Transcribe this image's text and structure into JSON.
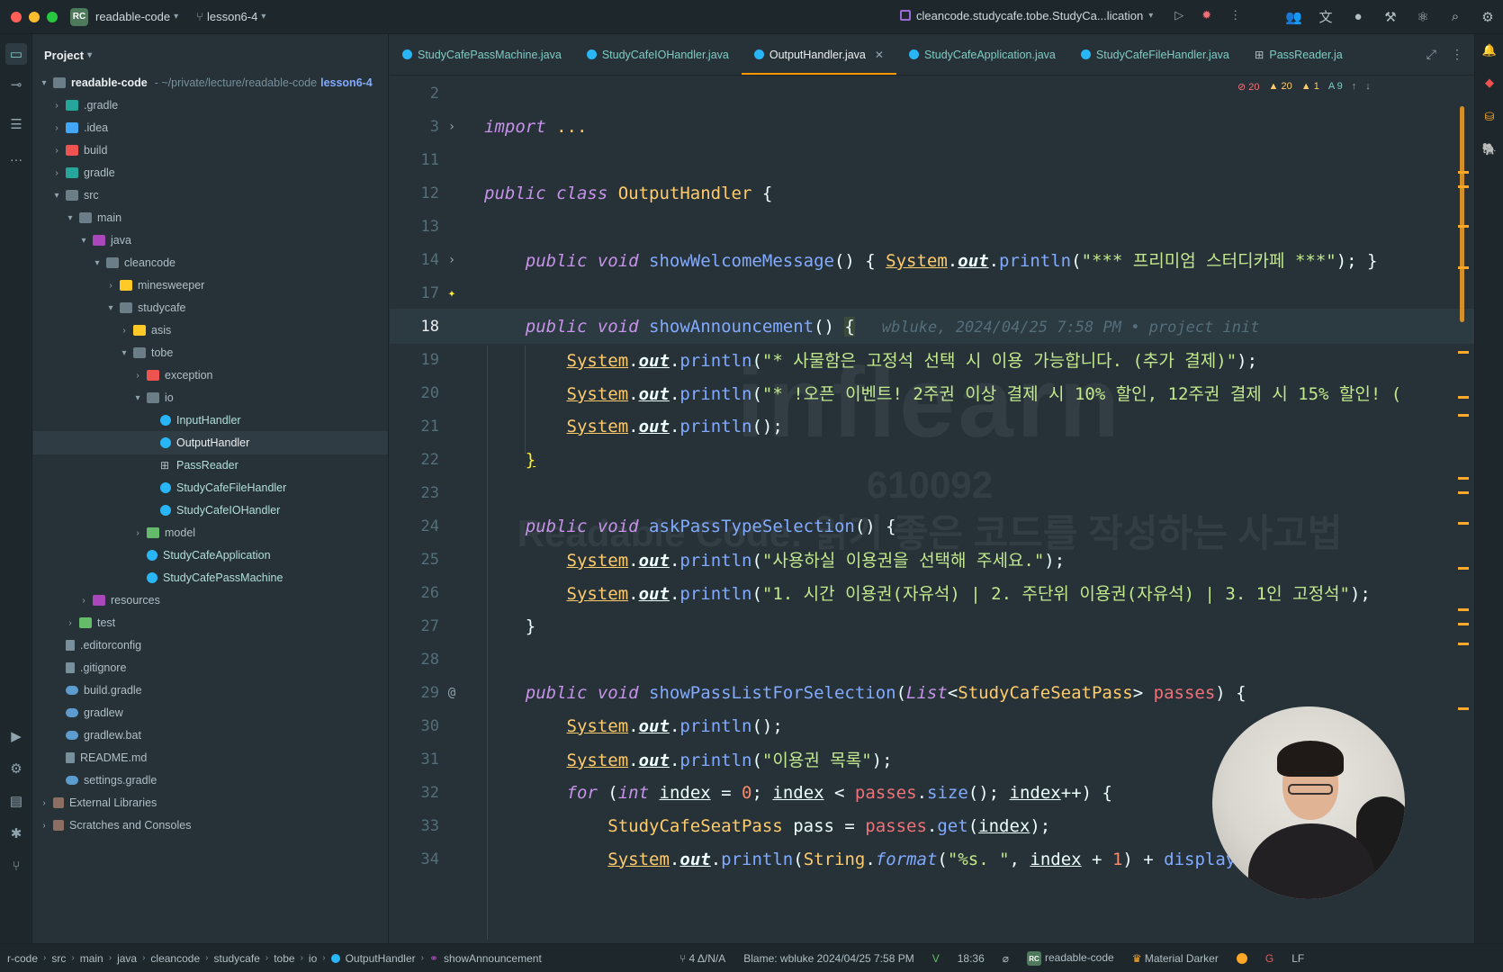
{
  "titlebar": {
    "project_badge": "RC",
    "project_name": "readable-code",
    "branch": "lesson6-4",
    "run_config": "cleancode.studycafe.tobe.StudyCa...lication"
  },
  "project_panel": {
    "title": "Project",
    "root": {
      "name": "readable-code",
      "path": "~/private/lecture/readable-code",
      "branch": "lesson6-4"
    },
    "items": [
      {
        "label": ".gradle"
      },
      {
        "label": ".idea"
      },
      {
        "label": "build"
      },
      {
        "label": "gradle"
      },
      {
        "label": "src"
      },
      {
        "label": "main"
      },
      {
        "label": "java"
      },
      {
        "label": "cleancode"
      },
      {
        "label": "minesweeper"
      },
      {
        "label": "studycafe"
      },
      {
        "label": "asis"
      },
      {
        "label": "tobe"
      },
      {
        "label": "exception"
      },
      {
        "label": "io"
      },
      {
        "label": "InputHandler"
      },
      {
        "label": "OutputHandler"
      },
      {
        "label": "PassReader"
      },
      {
        "label": "StudyCafeFileHandler"
      },
      {
        "label": "StudyCafeIOHandler"
      },
      {
        "label": "model"
      },
      {
        "label": "StudyCafeApplication"
      },
      {
        "label": "StudyCafePassMachine"
      },
      {
        "label": "resources"
      },
      {
        "label": "test"
      },
      {
        "label": ".editorconfig"
      },
      {
        "label": ".gitignore"
      },
      {
        "label": "build.gradle"
      },
      {
        "label": "gradlew"
      },
      {
        "label": "gradlew.bat"
      },
      {
        "label": "README.md"
      },
      {
        "label": "settings.gradle"
      },
      {
        "label": "External Libraries"
      },
      {
        "label": "Scratches and Consoles"
      }
    ]
  },
  "tabs": [
    {
      "label": "StudyCafePassMachine.java"
    },
    {
      "label": "StudyCafeIOHandler.java"
    },
    {
      "label": "OutputHandler.java",
      "active": true
    },
    {
      "label": "StudyCafeApplication.java"
    },
    {
      "label": "StudyCafeFileHandler.java"
    },
    {
      "label": "PassReader.ja"
    }
  ],
  "inspections": {
    "errors": "20",
    "warnings": "20",
    "weak_warnings": "1",
    "typos": "9"
  },
  "watermark": {
    "logo": "inflearn",
    "id": "610092",
    "title": "Readable Code: 읽기 좋은 코드를 작성하는 사고법"
  },
  "code": {
    "line_numbers": [
      "2",
      "3",
      "11",
      "12",
      "13",
      "14",
      "17",
      "18",
      "19",
      "20",
      "21",
      "22",
      "23",
      "24",
      "25",
      "26",
      "27",
      "28",
      "29",
      "30",
      "31",
      "32",
      "33",
      "34"
    ],
    "import_text": "import",
    "import_ellipsis": "...",
    "class_name": "OutputHandler",
    "welcome_method": "showWelcomeMessage",
    "welcome_string": "\"*** 프리미엄 스터디카페 ***\"",
    "announce_method": "showAnnouncement",
    "blame": "wbluke, 2024/04/25 7:58 PM • project init",
    "announce_str1": "\"* 사물함은 고정석 선택 시 이용 가능합니다. (추가 결제)\"",
    "announce_str2": "\"* !오픈 이벤트! 2주권 이상 결제 시 10% 할인, 12주권 결제 시 15% 할인! (",
    "ask_method": "askPassTypeSelection",
    "ask_str1": "\"사용하실 이용권을 선택해 주세요.\"",
    "ask_str2": "\"1. 시간 이용권(자유석) | 2. 주단위 이용권(자유석) | 3. 1인 고정석\"",
    "list_method": "showPassListForSelection",
    "list_type": "StudyCafeSeatPass",
    "list_param": "passes",
    "list_str": "\"이용권 목록\"",
    "format_str": "\"%s. \""
  },
  "statusbar": {
    "breadcrumb": [
      "r-code",
      "src",
      "main",
      "java",
      "cleancode",
      "studycafe",
      "tobe",
      "io",
      "OutputHandler",
      "showAnnouncement"
    ],
    "vcs_changes": "4 Δ/N/A",
    "blame": "Blame: wbluke 2024/04/25 7:58 PM",
    "time": "18:36",
    "project": "readable-code",
    "theme": "Material Darker",
    "line_sep": "LF"
  }
}
